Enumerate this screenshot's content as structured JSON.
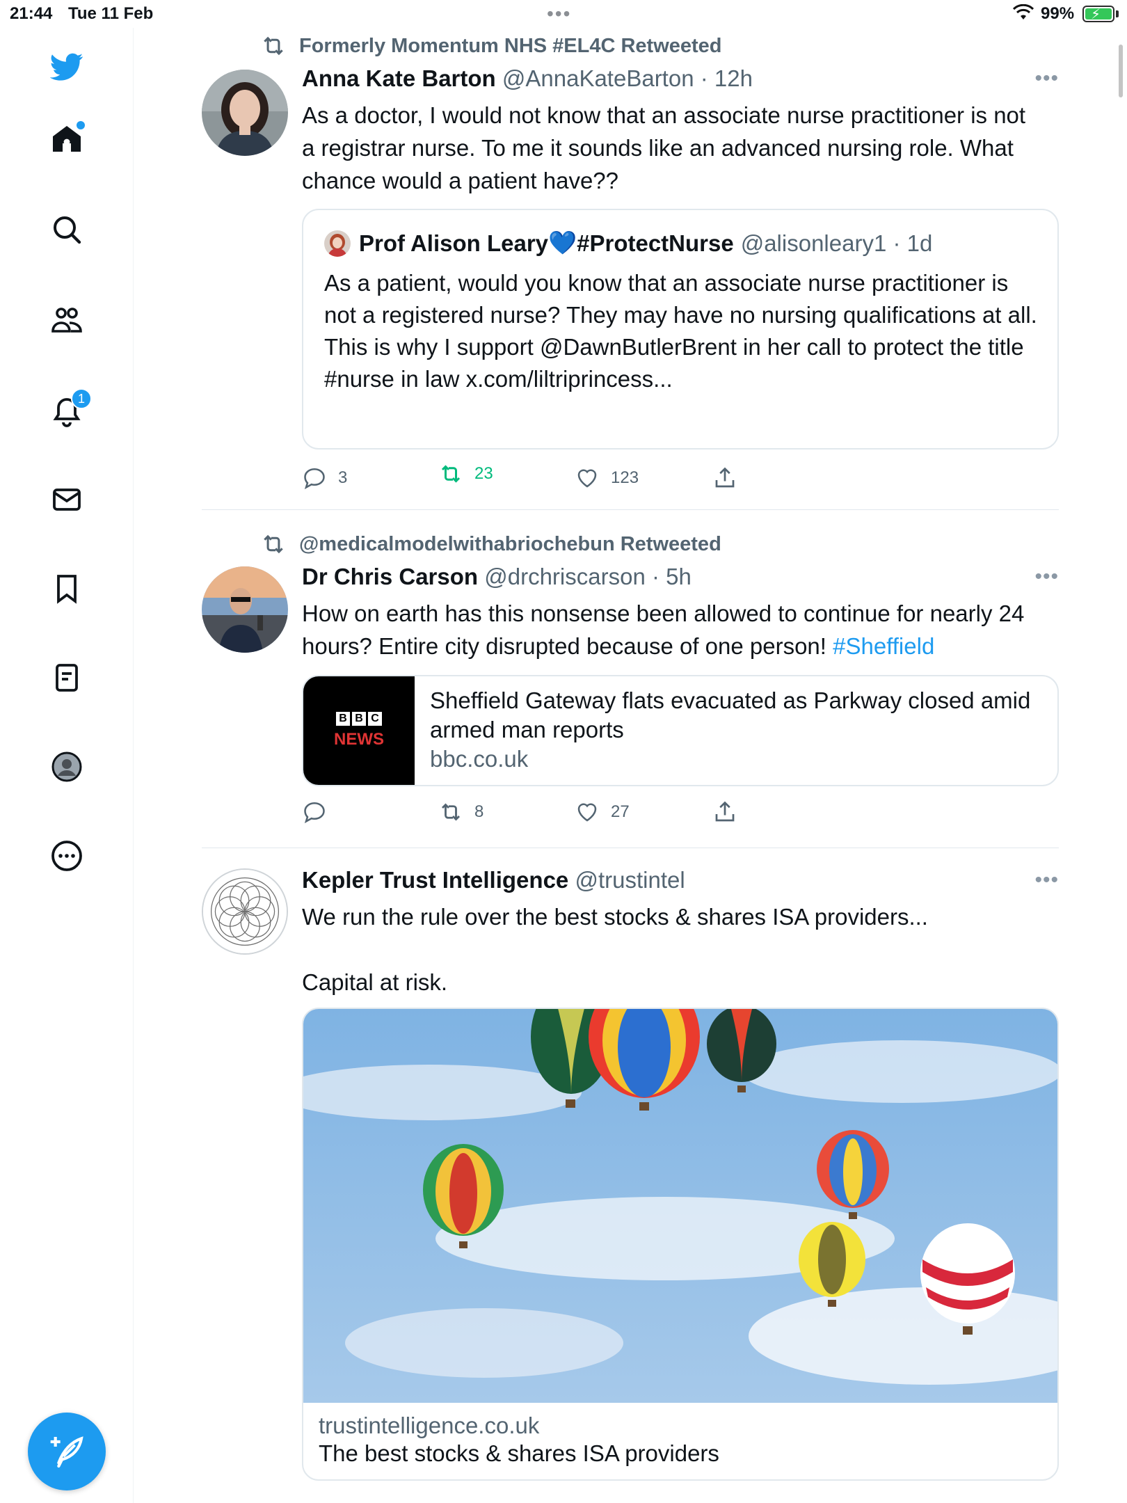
{
  "status_bar": {
    "time": "21:44",
    "date": "Tue 11 Feb",
    "battery": "99%",
    "battery_level": 0.99
  },
  "sidebar": {
    "items": [
      "twitter-logo",
      "home",
      "search",
      "communities",
      "notifications",
      "messages",
      "bookmarks",
      "lists",
      "profile",
      "more"
    ],
    "notifications_badge": "1"
  },
  "colors": {
    "accent": "#1d9bf0",
    "retweet_green": "#00ba7c",
    "muted": "#536471"
  },
  "tweets": [
    {
      "retweeted_by": "Formerly Momentum NHS #EL4C Retweeted",
      "name": "Anna Kate Barton",
      "meta": "@AnnaKateBarton · 12h",
      "text": "As a doctor, I would not know that an associate nurse practitioner is not a registrar nurse. To me it sounds like an advanced nursing role. What chance would a patient have??",
      "quote": {
        "name_a": "Prof Alison Leary ",
        "name_heart": "💙",
        "name_b": "#ProtectNurse",
        "meta": "@alisonleary1 · 1d",
        "line1": "As a patient, would you know that an associate nurse practitioner is not a registered nurse?  They may have no nursing qualifications at all.",
        "line2": "This is why I support @DawnButlerBrent in her call to protect the title #nurse in law x.com/liltriprincess..."
      },
      "replies": "3",
      "retweets": "23",
      "likes": "123"
    },
    {
      "retweeted_by": "@medicalmodelwithabriochebun Retweeted",
      "name": "Dr Chris Carson",
      "meta": "@drchriscarson · 5h",
      "text": "How on earth has this nonsense been allowed to continue for nearly 24 hours? Entire city disrupted because of one person! ",
      "hashtag": "#Sheffield",
      "link_card": {
        "logo_letters": [
          "B",
          "B",
          "C"
        ],
        "logo_word": "NEWS",
        "title": "Sheffield Gateway flats evacuated as Parkway closed amid armed man reports",
        "domain": "bbc.co.uk"
      },
      "replies": "",
      "retweets": "8",
      "likes": "27"
    },
    {
      "name": "Kepler Trust Intelligence",
      "meta": "@trustintel",
      "text_line1": "We run the rule over the best stocks & shares ISA providers...",
      "text_line2": "Capital at risk.",
      "media_card": {
        "domain": "trustintelligence.co.uk",
        "title": "The best stocks & shares ISA providers"
      }
    }
  ]
}
